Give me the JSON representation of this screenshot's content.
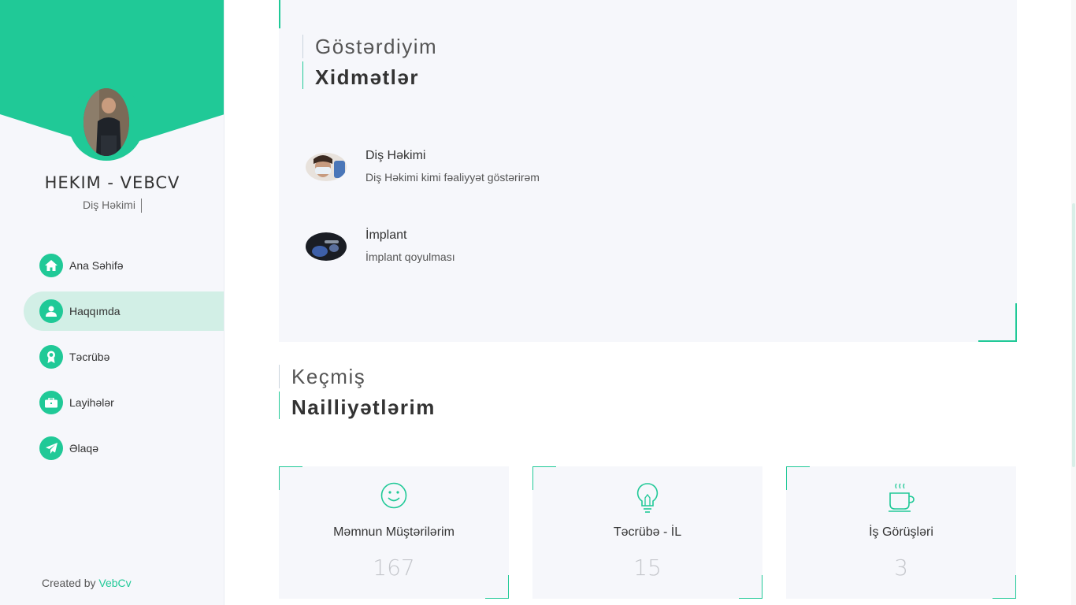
{
  "sidebar": {
    "name": "HEKIM - VEBCV",
    "role": "Diş Həkimi",
    "nav": [
      {
        "label": "Ana Səhifə",
        "icon": "home-icon",
        "active": false
      },
      {
        "label": "Haqqımda",
        "icon": "user-icon",
        "active": true
      },
      {
        "label": "Təcrübə",
        "icon": "award-icon",
        "active": false
      },
      {
        "label": "Layihələr",
        "icon": "briefcase-icon",
        "active": false
      },
      {
        "label": "Əlaqə",
        "icon": "paper-plane-icon",
        "active": false
      }
    ],
    "credit_prefix": "Created by",
    "credit_link": "VebCv"
  },
  "services": {
    "subtitle": "Göstərdiyim",
    "title": "Xidmətlər",
    "items": [
      {
        "title": "Diş Həkimi",
        "description": "Diş Həkimi kimi fəaliyyət göstərirəm"
      },
      {
        "title": "İmplant",
        "description": "İmplant qoyulması"
      }
    ]
  },
  "achievements": {
    "subtitle": "Keçmiş",
    "title": "Nailliyətlərim",
    "stats": [
      {
        "label": "Məmnun Müştərilərim",
        "value": "167",
        "icon": "smile-icon"
      },
      {
        "label": "Təcrübə - İL",
        "value": "15",
        "icon": "lightbulb-icon"
      },
      {
        "label": "İş Görüşləri",
        "value": "3",
        "icon": "coffee-cup-icon"
      }
    ]
  },
  "colors": {
    "accent": "#20c997",
    "active_nav_bg": "#d2efe6",
    "panel_bg": "#f6f7fb"
  }
}
